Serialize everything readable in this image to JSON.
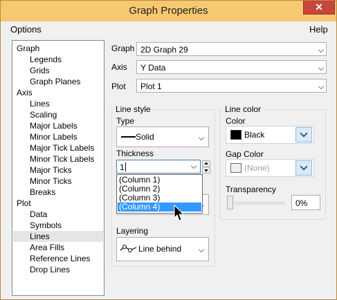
{
  "window": {
    "title": "Graph Properties",
    "close_glyph": "✕"
  },
  "menu": {
    "options": "Options",
    "help": "Help"
  },
  "tree": [
    {
      "label": "Graph"
    },
    {
      "label": "Legends"
    },
    {
      "label": "Grids"
    },
    {
      "label": "Graph Planes"
    },
    {
      "label": "Axis"
    },
    {
      "label": "Lines"
    },
    {
      "label": "Scaling"
    },
    {
      "label": "Major Labels"
    },
    {
      "label": "Minor Labels"
    },
    {
      "label": "Major Tick Labels"
    },
    {
      "label": "Minor Tick Labels"
    },
    {
      "label": "Major Ticks"
    },
    {
      "label": "Minor Ticks"
    },
    {
      "label": "Breaks"
    },
    {
      "label": "Plot"
    },
    {
      "label": "Data"
    },
    {
      "label": "Symbols"
    },
    {
      "label": "Lines",
      "selected": true
    },
    {
      "label": "Area Fills"
    },
    {
      "label": "Reference Lines"
    },
    {
      "label": "Drop Lines"
    }
  ],
  "selectors": {
    "graph_label": "Graph",
    "graph_value": "2D Graph 29",
    "axis_label": "Axis",
    "axis_value": "Y Data",
    "plot_label": "Plot",
    "plot_value": "Plot 1"
  },
  "line_style": {
    "group_title": "Line style",
    "type_label": "Type",
    "type_value": "Solid",
    "thickness_label": "Thickness",
    "thickness_value": "1",
    "thickness_options": [
      "(Column 1)",
      "(Column 2)",
      "(Column 3)",
      "(Column 4)"
    ],
    "highlighted_option": "(Column 4)",
    "layering_label": "Layering",
    "layering_value": "Line behind"
  },
  "line_color": {
    "group_title": "Line color",
    "color_label": "Color",
    "color_value": "Black",
    "color_swatch": "#000000",
    "gap_label": "Gap Color",
    "gap_value": "(None)",
    "gap_swatch": "#f0f0f0",
    "transparency_label": "Transparency",
    "transparency_value": "0%"
  },
  "colors": {
    "titlebar": "#f6c872",
    "close": "#c7453b",
    "highlight": "#3399ff"
  }
}
